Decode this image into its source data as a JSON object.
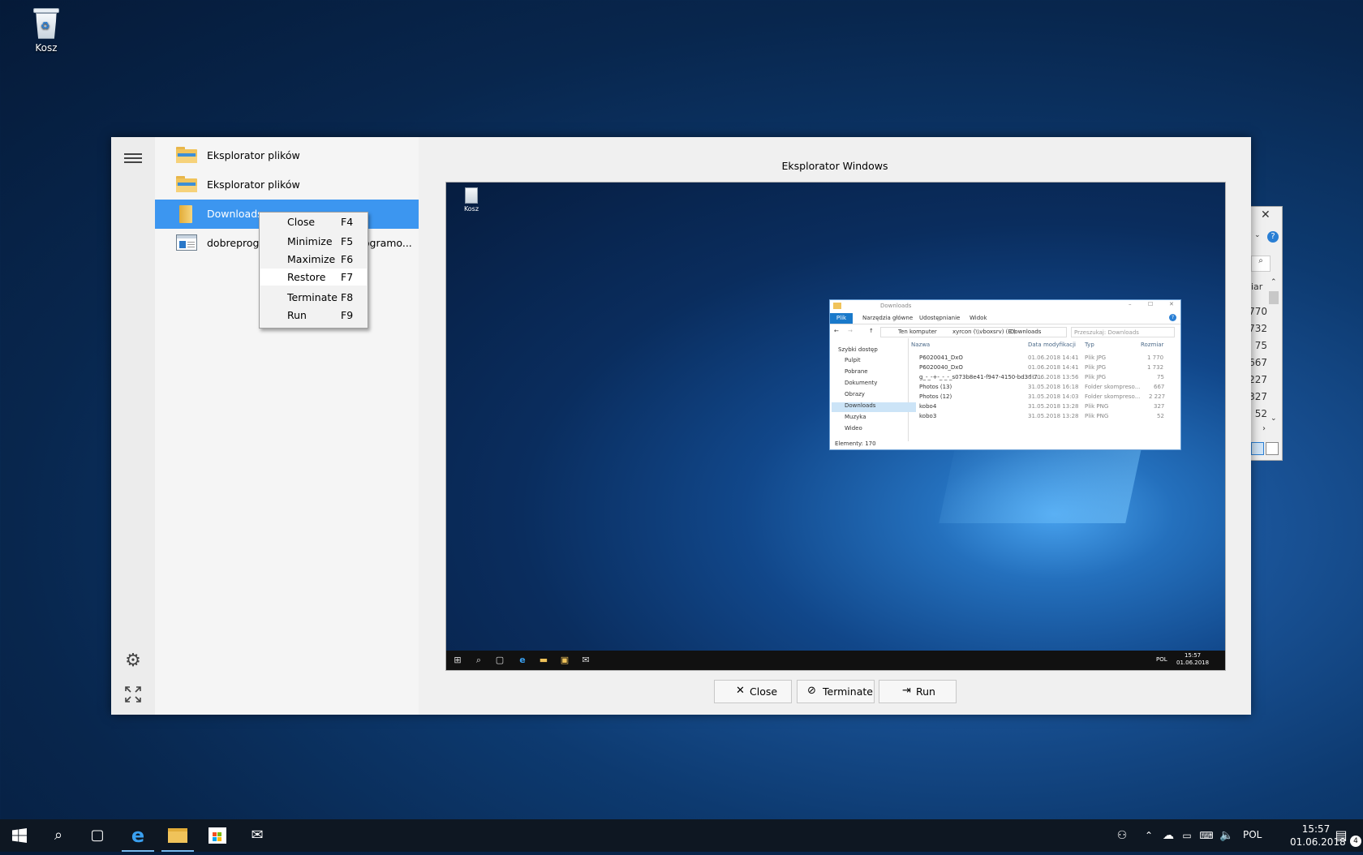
{
  "desktop": {
    "recycle_bin_label": "Kosz"
  },
  "app": {
    "list": [
      {
        "label": "Eksplorator plików",
        "icon": "file-explorer-icon"
      },
      {
        "label": "Eksplorator plików",
        "icon": "file-explorer-icon"
      },
      {
        "label": "Downloads",
        "icon": "folder-icon"
      },
      {
        "label": "dobreprograms",
        "label_tail": "rogramo...",
        "icon": "window-icon"
      }
    ],
    "preview_title": "Eksplorator Windows",
    "buttons": {
      "close": "Close",
      "terminate": "Terminate",
      "run": "Run"
    },
    "context_menu": [
      {
        "label": "Close",
        "key": "F4"
      },
      {
        "label": "Minimize",
        "key": "F5"
      },
      {
        "label": "Maximize",
        "key": "F6"
      },
      {
        "label": "Restore",
        "key": "F7"
      },
      {
        "label": "Terminate",
        "key": "F8"
      },
      {
        "label": "Run",
        "key": "F9"
      }
    ]
  },
  "preview": {
    "recycle_bin_label": "Kosz",
    "explorer": {
      "title": "Downloads",
      "ribbon_tabs": [
        "Plik",
        "Narzędzia główne",
        "Udostępnianie",
        "Widok"
      ],
      "breadcrumb": [
        "Ten komputer",
        "xyrcon (\\\\vboxsrv) (E:)",
        "Downloads"
      ],
      "search_placeholder": "Przeszukaj: Downloads",
      "nav": [
        "Szybki dostęp",
        "Pulpit",
        "Pobrane",
        "Dokumenty",
        "Obrazy",
        "Downloads",
        "Muzyka",
        "Wideo"
      ],
      "columns": [
        "Nazwa",
        "Data modyfikacji",
        "Typ",
        "Rozmiar"
      ],
      "rows": [
        [
          "P6020041_DxO",
          "01.06.2018 14:41",
          "Plik JPG",
          "1 770"
        ],
        [
          "P6020040_DxO",
          "01.06.2018 14:41",
          "Plik JPG",
          "1 732"
        ],
        [
          "g_-_-+-_-_-_s073b8e41-f947-4150-bd3d-7...",
          "01.06.2018 13:56",
          "Plik JPG",
          "75"
        ],
        [
          "Photos (13)",
          "31.05.2018 16:18",
          "Folder skompreso...",
          "667"
        ],
        [
          "Photos (12)",
          "31.05.2018 14:03",
          "Folder skompreso...",
          "2 227"
        ],
        [
          "kobo4",
          "31.05.2018 13:28",
          "Plik PNG",
          "327"
        ],
        [
          "kobo3",
          "31.05.2018 13:28",
          "Plik PNG",
          "52"
        ]
      ],
      "status": "Elementy: 170"
    },
    "tray_lang": "POL",
    "tray_time": "15:57",
    "tray_date": "01.06.2018"
  },
  "side_window": {
    "partial_label": "iar",
    "values": [
      "770",
      "732",
      "75",
      "667",
      "227",
      "327",
      "52"
    ]
  },
  "taskbar": {
    "lang": "POL",
    "time": "15:57",
    "date": "01.06.2018",
    "notifications": "4"
  }
}
